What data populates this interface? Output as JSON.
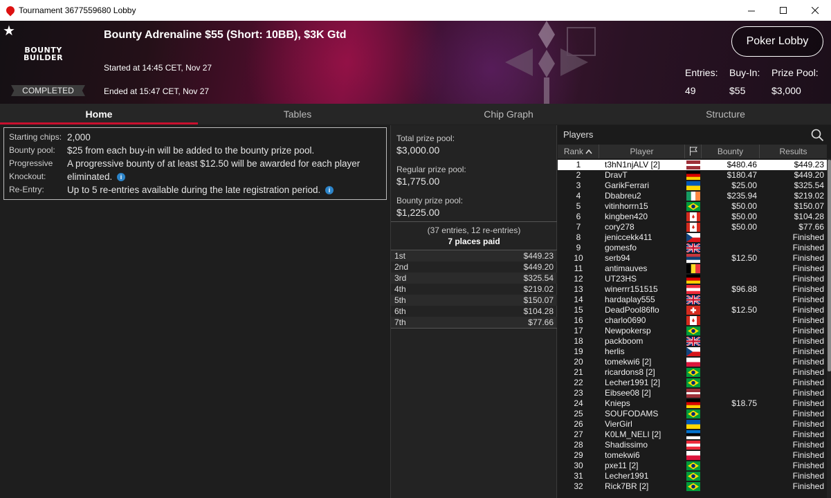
{
  "window": {
    "title": "Tournament 3677559680 Lobby",
    "minimize": "–",
    "maximize": "☐",
    "close": "✕"
  },
  "banner": {
    "logo_line1": "BOUNTY",
    "logo_line2": "BUILDER",
    "status": "COMPLETED",
    "title": "Bounty Adrenaline $55 (Short: 10BB), $3K Gtd",
    "started": "Started at 14:45 CET, Nov 27",
    "ended": "Ended at 15:47 CET, Nov 27",
    "lobby_button": "Poker Lobby",
    "entries_label": "Entries:",
    "entries_value": "49",
    "buyin_label": "Buy-In:",
    "buyin_value": "$55",
    "prizepool_label": "Prize Pool:",
    "prizepool_value": "$3,000"
  },
  "tabs": [
    "Home",
    "Tables",
    "Chip Graph",
    "Structure"
  ],
  "info": {
    "starting_chips_label": "Starting chips:",
    "starting_chips": "2,000",
    "bounty_pool_label": "Bounty pool:",
    "bounty_pool": "$25 from each buy-in will be added to the bounty prize pool.",
    "pk_label1": "Progressive",
    "pk_label2": "Knockout:",
    "pk_line1": "A progressive bounty of at least $12.50 will be awarded for each player",
    "pk_line2": "eliminated.",
    "reentry_label": "Re-Entry:",
    "reentry": "Up to 5 re-entries available during the late registration period.",
    "info_icon": "i"
  },
  "prize": {
    "total_label": "Total prize pool:",
    "total": "$3,000.00",
    "regular_label": "Regular prize pool:",
    "regular": "$1,775.00",
    "bounty_label": "Bounty prize pool:",
    "bounty": "$1,225.00",
    "entries_line": "(37 entries, 12 re-entries)",
    "places_paid": "7 places paid",
    "payouts": [
      {
        "place": "1st",
        "amount": "$449.23"
      },
      {
        "place": "2nd",
        "amount": "$449.20"
      },
      {
        "place": "3rd",
        "amount": "$325.54"
      },
      {
        "place": "4th",
        "amount": "$219.02"
      },
      {
        "place": "5th",
        "amount": "$150.07"
      },
      {
        "place": "6th",
        "amount": "$104.28"
      },
      {
        "place": "7th",
        "amount": "$77.66"
      }
    ]
  },
  "players": {
    "header": "Players",
    "columns": {
      "rank": "Rank",
      "player": "Player",
      "bounty": "Bounty",
      "results": "Results"
    },
    "rows": [
      {
        "rank": "1",
        "name": "t3hN1njALV [2]",
        "flag": "latvia",
        "bounty": "$480.46",
        "result": "$449.23"
      },
      {
        "rank": "2",
        "name": "DravT",
        "flag": "germany",
        "bounty": "$180.47",
        "result": "$449.20"
      },
      {
        "rank": "3",
        "name": "GarikFerrari",
        "flag": "ukraine",
        "bounty": "$25.00",
        "result": "$325.54"
      },
      {
        "rank": "4",
        "name": "Dbabreu2",
        "flag": "ireland",
        "bounty": "$235.94",
        "result": "$219.02"
      },
      {
        "rank": "5",
        "name": "vitinhorrn15",
        "flag": "brazil",
        "bounty": "$50.00",
        "result": "$150.07"
      },
      {
        "rank": "6",
        "name": "kingben420",
        "flag": "canada",
        "bounty": "$50.00",
        "result": "$104.28"
      },
      {
        "rank": "7",
        "name": "cory278",
        "flag": "canada",
        "bounty": "$50.00",
        "result": "$77.66"
      },
      {
        "rank": "8",
        "name": "jeniccekk411",
        "flag": "czech",
        "bounty": "",
        "result": "Finished"
      },
      {
        "rank": "9",
        "name": "gomesfo",
        "flag": "uk",
        "bounty": "",
        "result": "Finished"
      },
      {
        "rank": "10",
        "name": "serb94",
        "flag": "serbia",
        "bounty": "$12.50",
        "result": "Finished"
      },
      {
        "rank": "11",
        "name": "antimauves",
        "flag": "belgium",
        "bounty": "",
        "result": "Finished"
      },
      {
        "rank": "12",
        "name": "UT23HS",
        "flag": "germany",
        "bounty": "",
        "result": "Finished"
      },
      {
        "rank": "13",
        "name": "winerrr151515",
        "flag": "austria",
        "bounty": "$96.88",
        "result": "Finished"
      },
      {
        "rank": "14",
        "name": "hardaplay555",
        "flag": "uk",
        "bounty": "",
        "result": "Finished"
      },
      {
        "rank": "15",
        "name": "DeadPool86flo",
        "flag": "switzerland",
        "bounty": "$12.50",
        "result": "Finished"
      },
      {
        "rank": "16",
        "name": "charlo0690",
        "flag": "canada",
        "bounty": "",
        "result": "Finished"
      },
      {
        "rank": "17",
        "name": "Newpokersp",
        "flag": "brazil",
        "bounty": "",
        "result": "Finished"
      },
      {
        "rank": "18",
        "name": "packboom",
        "flag": "uk",
        "bounty": "",
        "result": "Finished"
      },
      {
        "rank": "19",
        "name": "herlis",
        "flag": "czech",
        "bounty": "",
        "result": "Finished"
      },
      {
        "rank": "20",
        "name": "tomekwi6 [2]",
        "flag": "poland",
        "bounty": "",
        "result": "Finished"
      },
      {
        "rank": "21",
        "name": "ricardons8 [2]",
        "flag": "brazil",
        "bounty": "",
        "result": "Finished"
      },
      {
        "rank": "22",
        "name": "Lecher1991 [2]",
        "flag": "brazil",
        "bounty": "",
        "result": "Finished"
      },
      {
        "rank": "23",
        "name": "Eibsee08 [2]",
        "flag": "latvia",
        "bounty": "",
        "result": "Finished"
      },
      {
        "rank": "24",
        "name": "Knieps",
        "flag": "germany",
        "bounty": "$18.75",
        "result": "Finished"
      },
      {
        "rank": "25",
        "name": "SOUFODAMS",
        "flag": "brazil",
        "bounty": "",
        "result": "Finished"
      },
      {
        "rank": "26",
        "name": "VierGirl",
        "flag": "ukraine",
        "bounty": "",
        "result": "Finished"
      },
      {
        "rank": "27",
        "name": "K0LM_NELI [2]",
        "flag": "estonia",
        "bounty": "",
        "result": "Finished"
      },
      {
        "rank": "28",
        "name": "Shadissimo",
        "flag": "austria",
        "bounty": "",
        "result": "Finished"
      },
      {
        "rank": "29",
        "name": "tomekwi6",
        "flag": "poland",
        "bounty": "",
        "result": "Finished"
      },
      {
        "rank": "30",
        "name": "pxe11 [2]",
        "flag": "brazil",
        "bounty": "",
        "result": "Finished"
      },
      {
        "rank": "31",
        "name": "Lecher1991",
        "flag": "brazil",
        "bounty": "",
        "result": "Finished"
      },
      {
        "rank": "32",
        "name": "Rick7BR [2]",
        "flag": "brazil",
        "bounty": "",
        "result": "Finished"
      }
    ]
  },
  "colors": {
    "accent": "#c8102e",
    "info_icon": "#2c84c9"
  },
  "icons": {
    "star": "star-icon",
    "search": "search-icon",
    "flag_column": "flag-icon",
    "sort": "sort-up-icon"
  }
}
